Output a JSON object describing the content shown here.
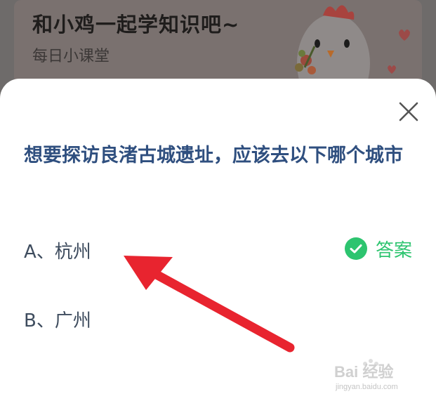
{
  "banner": {
    "title": "和小鸡一起学知识吧~",
    "subtitle": "每日小课堂"
  },
  "quiz": {
    "question": "想要探访良渚古城遗址，应该去以下哪个城市",
    "options": [
      {
        "label": "A、杭州",
        "is_answer": true
      },
      {
        "label": "B、广州",
        "is_answer": false
      }
    ],
    "answer_label": "答案"
  },
  "watermark": {
    "brand": "Bai 经验",
    "url": "jingyan.baidu.com"
  },
  "colors": {
    "question": "#2f4f7f",
    "answer_green": "#2dc46f",
    "arrow_red": "#e8242f"
  },
  "icons": [
    "close-icon",
    "check-circle-icon",
    "chicken-mascot",
    "paw-icon"
  ]
}
